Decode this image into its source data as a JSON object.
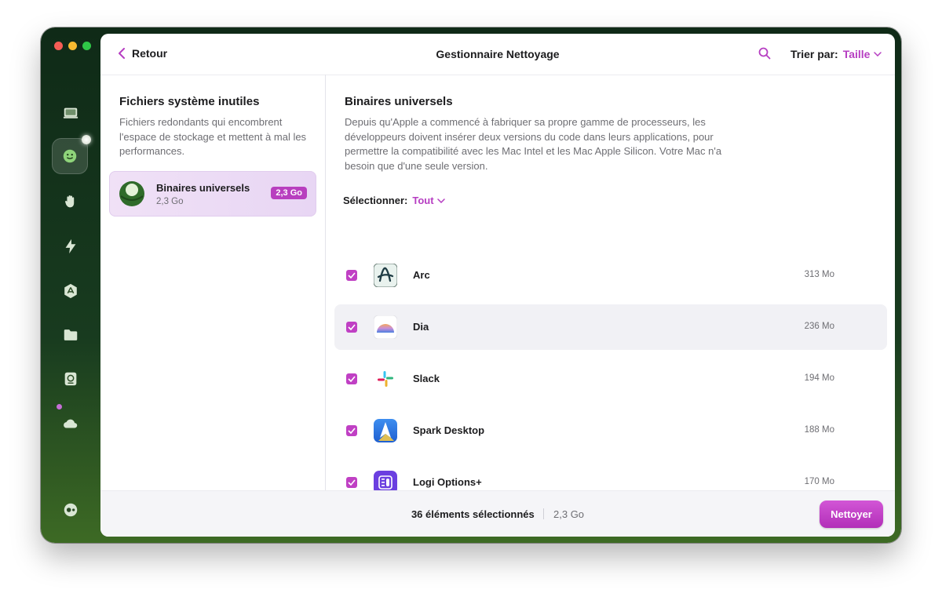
{
  "window": {
    "title": "Gestionnaire Nettoyage",
    "back_label": "Retour",
    "sort_label": "Trier par:",
    "sort_value": "Taille"
  },
  "sidebar": {
    "icons": [
      "monitor-icon",
      "smiley-icon",
      "hand-icon",
      "lightning-icon",
      "app-store-icon",
      "folder-icon",
      "disk-icon",
      "cloud-icon",
      "settings-toggle-icon"
    ]
  },
  "left": {
    "title": "Fichiers système inutiles",
    "description": "Fichiers redondants qui encombrent l'espace de stockage et mettent à mal les performances.",
    "category": {
      "name": "Binaires universels",
      "size": "2,3 Go",
      "badge": "2,3 Go"
    }
  },
  "right": {
    "title": "Binaires universels",
    "description": "Depuis qu'Apple a commencé à fabriquer sa propre gamme de processeurs, les développeurs doivent insérer deux versions du code dans leurs applications, pour permettre la compatibilité avec les Mac Intel et les Mac Apple Silicon. Votre Mac n'a besoin que d'une seule version.",
    "select_label": "Sélectionner:",
    "select_value": "Tout",
    "apps": [
      {
        "name": "Arc",
        "size": "313 Mo",
        "icon": "arc-app-icon"
      },
      {
        "name": "Dia",
        "size": "236 Mo",
        "icon": "dia-app-icon"
      },
      {
        "name": "Slack",
        "size": "194 Mo",
        "icon": "slack-app-icon"
      },
      {
        "name": "Spark Desktop",
        "size": "188 Mo",
        "icon": "spark-app-icon"
      },
      {
        "name": "Logi Options+",
        "size": "170 Mo",
        "icon": "logi-app-icon"
      }
    ]
  },
  "footer": {
    "selected_count": "36 éléments sélectionnés",
    "selected_size": "2,3 Go",
    "clean_button": "Nettoyer"
  },
  "colors": {
    "accent": "#b63ec2",
    "button": "#c040c4"
  }
}
